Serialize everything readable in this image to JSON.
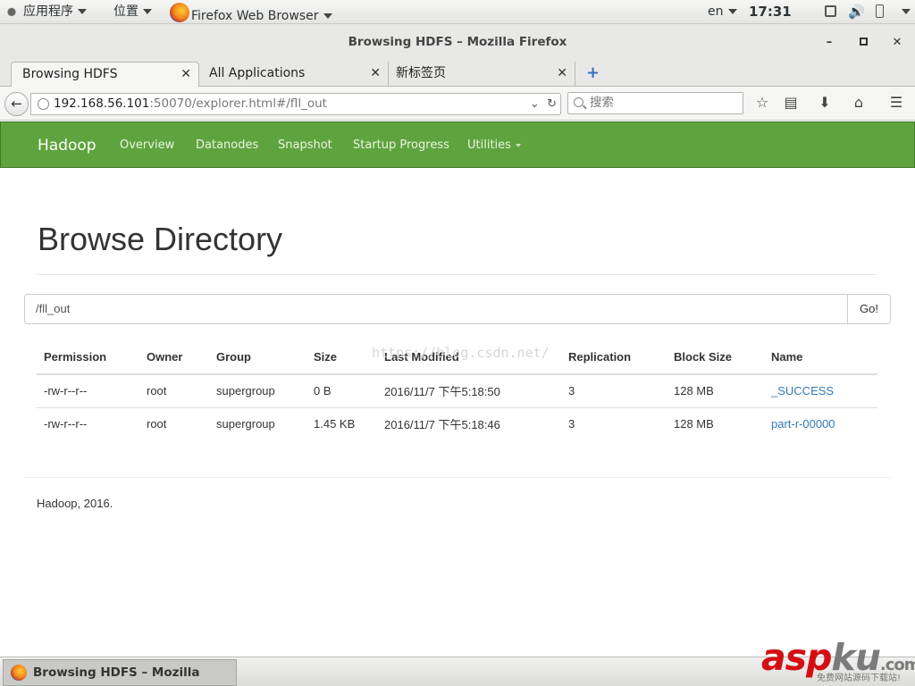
{
  "topbar": {
    "applications": "应用程序",
    "places": "位置",
    "active_app": "Firefox Web Browser",
    "lang": "en",
    "time": "17:31"
  },
  "window": {
    "title": "Browsing HDFS – Mozilla Firefox"
  },
  "tabs": [
    {
      "label": "Browsing HDFS"
    },
    {
      "label": "All Applications"
    },
    {
      "label": "新标签页"
    }
  ],
  "nav": {
    "url_host": "192.168.56.101",
    "url_rest": ":50070/explorer.html#/fll_out",
    "search_placeholder": "搜索"
  },
  "hadoop": {
    "brand": "Hadoop",
    "menu": [
      "Overview",
      "Datanodes",
      "Snapshot",
      "Startup Progress",
      "Utilities"
    ],
    "page_title": "Browse Directory",
    "path_value": "/fll_out",
    "go_label": "Go!",
    "columns": [
      "Permission",
      "Owner",
      "Group",
      "Size",
      "Last Modified",
      "Replication",
      "Block Size",
      "Name"
    ],
    "rows": [
      {
        "permission": "-rw-r--r--",
        "owner": "root",
        "group": "supergroup",
        "size": "0 B",
        "modified": "2016/11/7 下午5:18:50",
        "replication": "3",
        "block_size": "128 MB",
        "name": "_SUCCESS"
      },
      {
        "permission": "-rw-r--r--",
        "owner": "root",
        "group": "supergroup",
        "size": "1.45 KB",
        "modified": "2016/11/7 下午5:18:46",
        "replication": "3",
        "block_size": "128 MB",
        "name": "part-r-00000"
      }
    ],
    "footer": "Hadoop, 2016."
  },
  "watermark": "https://blog.csdn.net/",
  "taskbar": {
    "task_label": "Browsing HDFS – Mozilla Firefox"
  },
  "logo": {
    "asp": "asp",
    "ku": "ku",
    "dot": ".com",
    "sub": "免费网站源码下载站!"
  },
  "colors": {
    "hadoop_green": "#5fa33e",
    "link_blue": "#337ab7",
    "logo_red": "#d40f12"
  }
}
